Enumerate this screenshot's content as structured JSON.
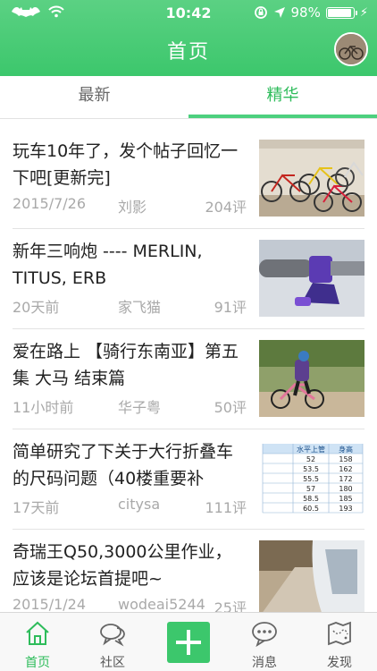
{
  "status_bar": {
    "time": "10:42",
    "battery": "98%",
    "battery_level": 0.98
  },
  "header": {
    "title": "首页"
  },
  "tabs": [
    {
      "label": "最新",
      "active": false
    },
    {
      "label": "精华",
      "active": true
    }
  ],
  "posts": [
    {
      "title": "玩车10年了，发个帖子回忆一下吧[更新完]",
      "date": "2015/7/26",
      "author": "刘影",
      "comments": "204评"
    },
    {
      "title": "新年三响炮 ---- MERLIN, TITUS, ERB",
      "date": "20天前",
      "author": "家飞猫",
      "comments": "91评"
    },
    {
      "title": "爱在路上 【骑行东南亚】第五集 大马 结束篇",
      "date": "11小时前",
      "author": "华子粤",
      "comments": "50评"
    },
    {
      "title": "简单研究了下关于大行折叠车的尺码问题（40楼重要补",
      "date": "17天前",
      "author": "citysa",
      "comments": "111评"
    },
    {
      "title": "奇瑞王Q50,3000公里作业，应该是论坛首提吧~",
      "date": "2015/1/24",
      "author": "wodeai5244",
      "comments": "25评"
    }
  ],
  "size_table": {
    "headers": [
      "水平上管",
      "身高"
    ],
    "rows": [
      [
        "52",
        "158"
      ],
      [
        "53.5",
        "162"
      ],
      [
        "55.5",
        "172"
      ],
      [
        "57",
        "180"
      ],
      [
        "58.5",
        "185"
      ],
      [
        "60.5",
        "193"
      ]
    ]
  },
  "tabbar": [
    {
      "label": "首页",
      "icon": "home-icon",
      "active": true
    },
    {
      "label": "社区",
      "icon": "community-icon",
      "active": false
    },
    {
      "label": "",
      "icon": "plus-icon",
      "active": false
    },
    {
      "label": "消息",
      "icon": "message-icon",
      "active": false
    },
    {
      "label": "发现",
      "icon": "discover-map-icon",
      "active": false
    }
  ],
  "colors": {
    "brand_green": "#3cc76c",
    "active_tab": "#2ebc5b",
    "meta_gray": "#a9a9a9"
  }
}
